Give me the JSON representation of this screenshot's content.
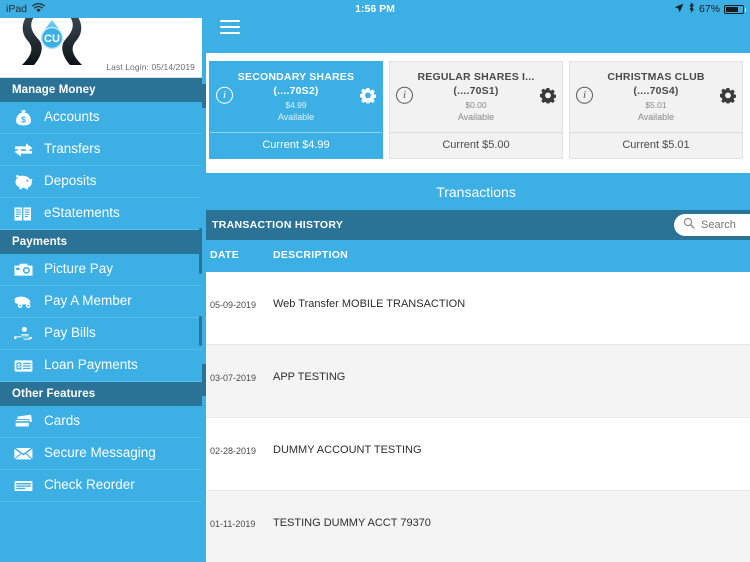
{
  "status_bar": {
    "device_label": "iPad",
    "wifi_icon": "wifi-icon",
    "time": "1:56 PM",
    "location_icon": "location-arrow-icon",
    "bluetooth_icon": "bluetooth-icon",
    "battery_percent": "67%",
    "battery_icon": "battery-icon"
  },
  "sidebar": {
    "logo": {
      "icon_name": "credit-union-logo",
      "mark_text": "CU"
    },
    "last_login": "Last Login:  05/14/2019",
    "sections": [
      {
        "header": "Manage Money",
        "items": [
          {
            "label": "Accounts",
            "icon": "money-bag-icon"
          },
          {
            "label": "Transfers",
            "icon": "transfer-arrows-icon"
          },
          {
            "label": "Deposits",
            "icon": "piggy-bank-icon"
          },
          {
            "label": "eStatements",
            "icon": "documents-icon"
          }
        ]
      },
      {
        "header": "Payments",
        "items": [
          {
            "label": "Picture Pay",
            "icon": "camera-icon"
          },
          {
            "label": "Pay A Member",
            "icon": "pay-member-icon"
          },
          {
            "label": "Pay Bills",
            "icon": "hand-coin-icon"
          },
          {
            "label": "Loan Payments",
            "icon": "loan-card-icon"
          }
        ]
      },
      {
        "header": "Other Features",
        "items": [
          {
            "label": "Cards",
            "icon": "cards-icon"
          },
          {
            "label": "Secure Messaging",
            "icon": "envelope-icon"
          },
          {
            "label": "Check Reorder",
            "icon": "check-icon"
          }
        ]
      }
    ]
  },
  "topbar": {
    "menu_icon": "hamburger-menu-icon"
  },
  "accounts": [
    {
      "name": "SECONDARY SHARES",
      "number": "(....70S2)",
      "available_amount": "$4.99",
      "available_label": "Available",
      "current": "Current $4.99",
      "selected": true,
      "info_icon": "info-icon",
      "gear_icon": "gear-icon"
    },
    {
      "name": "REGULAR SHARES I...",
      "number": "(....70S1)",
      "available_amount": "$0.00",
      "available_label": "Available",
      "current": "Current $5.00",
      "selected": false,
      "info_icon": "info-icon",
      "gear_icon": "gear-icon"
    },
    {
      "name": "CHRISTMAS CLUB",
      "number": "(....70S4)",
      "available_amount": "$5.01",
      "available_label": "Available",
      "current": "Current $5.01",
      "selected": false,
      "info_icon": "info-icon",
      "gear_icon": "gear-icon"
    }
  ],
  "transactions_panel": {
    "title": "Transactions",
    "history_label": "TRANSACTION HISTORY",
    "search": {
      "placeholder": "Search",
      "value": "",
      "icon": "search-icon"
    },
    "columns": {
      "date": "DATE",
      "description": "DESCRIPTION"
    },
    "rows": [
      {
        "date": "05-09-2019",
        "description": "Web Transfer MOBILE TRANSACTION"
      },
      {
        "date": "03-07-2019",
        "description": "APP TESTING"
      },
      {
        "date": "02-28-2019",
        "description": "DUMMY ACCOUNT TESTING"
      },
      {
        "date": "01-11-2019",
        "description": "TESTING DUMMY ACCT 79370"
      }
    ]
  },
  "colors": {
    "brand_blue": "#3CB0E5",
    "dark_blue": "#2B7396",
    "row_alt": "#F4F4F4",
    "card_grey": "#F2F2F2"
  }
}
